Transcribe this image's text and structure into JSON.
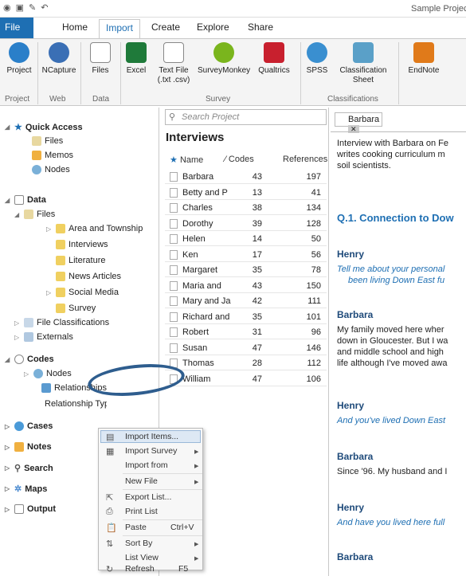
{
  "window": {
    "title": "Sample Project"
  },
  "tabs": [
    "File",
    "Home",
    "Import",
    "Create",
    "Explore",
    "Share"
  ],
  "ribbon": {
    "buttons": [
      {
        "label": "Project",
        "color": "#2a7fc9"
      },
      {
        "label": "NCapture",
        "color": "#3a6fb5"
      },
      {
        "label": "Files",
        "color": "#888888"
      },
      {
        "label": "Excel",
        "color": "#1f7a3a"
      },
      {
        "label": "Text File\n(.txt .csv)",
        "color": "#888888"
      },
      {
        "label": "SurveyMonkey",
        "color": "#7ab51d"
      },
      {
        "label": "Qualtrics",
        "color": "#c8202e"
      },
      {
        "label": "SPSS",
        "color": "#3a8fd0"
      },
      {
        "label": "Classification\nSheet",
        "color": "#5aa0c8"
      },
      {
        "label": "EndNote",
        "color": "#e07a1a"
      }
    ],
    "groups": [
      "Project",
      "Web",
      "Data",
      "Survey",
      "Classifications"
    ]
  },
  "nav": {
    "quick_access": "Quick Access",
    "qa_items": [
      "Files",
      "Memos",
      "Nodes"
    ],
    "data": "Data",
    "files": "Files",
    "file_folders": [
      "Area and Township",
      "Interviews",
      "Literature",
      "News Articles",
      "Social Media",
      "Survey"
    ],
    "file_classifications": "File Classifications",
    "externals": "Externals",
    "codes": "Codes",
    "code_items": [
      "Nodes",
      "Relationships",
      "Relationship Types"
    ],
    "sections": [
      "Cases",
      "Notes",
      "Search",
      "Maps",
      "Output"
    ]
  },
  "list": {
    "search_placeholder": "Search Project",
    "title": "Interviews",
    "columns": [
      "Name",
      "Codes",
      "References"
    ],
    "rows": [
      {
        "name": "Barbara",
        "codes": "43",
        "refs": "197"
      },
      {
        "name": "Betty and P",
        "codes": "13",
        "refs": "41"
      },
      {
        "name": "Charles",
        "codes": "38",
        "refs": "134"
      },
      {
        "name": "Dorothy",
        "codes": "39",
        "refs": "128"
      },
      {
        "name": "Helen",
        "codes": "14",
        "refs": "50"
      },
      {
        "name": "Ken",
        "codes": "17",
        "refs": "56"
      },
      {
        "name": "Margaret",
        "codes": "35",
        "refs": "78"
      },
      {
        "name": "Maria and",
        "codes": "43",
        "refs": "150"
      },
      {
        "name": "Mary and Ja",
        "codes": "42",
        "refs": "111"
      },
      {
        "name": "Richard and",
        "codes": "35",
        "refs": "101"
      },
      {
        "name": "Robert",
        "codes": "31",
        "refs": "96"
      },
      {
        "name": "Susan",
        "codes": "47",
        "refs": "146"
      },
      {
        "name": "Thomas",
        "codes": "28",
        "refs": "112"
      },
      {
        "name": "William",
        "codes": "47",
        "refs": "106"
      }
    ]
  },
  "detail": {
    "tab": "Barbara",
    "intro": [
      "Interview with Barbara on Fe",
      "writes cooking curriculum m",
      "soil scientists."
    ],
    "heading": "Q.1. Connection to Dow",
    "speaker_henry": "Henry",
    "speaker_barbara": "Barbara",
    "q1": [
      "Tell me about your personal",
      "been living Down East fu"
    ],
    "a1": [
      "My family moved here wher",
      "down in Gloucester. But I wa",
      "and middle school and high",
      "life although I've moved awa"
    ],
    "q2": "And you've lived Down East",
    "a2": "Since '96. My husband and I",
    "q3": "And have you lived here full"
  },
  "context_menu": [
    {
      "label": "Import Items...",
      "shortcut": ""
    },
    {
      "label": "Import Survey",
      "shortcut": ""
    },
    {
      "label": "Import from",
      "shortcut": ""
    },
    {
      "label": "New File",
      "shortcut": ""
    },
    {
      "label": "Export List...",
      "shortcut": ""
    },
    {
      "label": "Print List",
      "shortcut": ""
    },
    {
      "label": "Paste",
      "shortcut": "Ctrl+V"
    },
    {
      "label": "Sort By",
      "shortcut": ""
    },
    {
      "label": "List View",
      "shortcut": ""
    },
    {
      "label": "Refresh",
      "shortcut": "F5"
    }
  ]
}
